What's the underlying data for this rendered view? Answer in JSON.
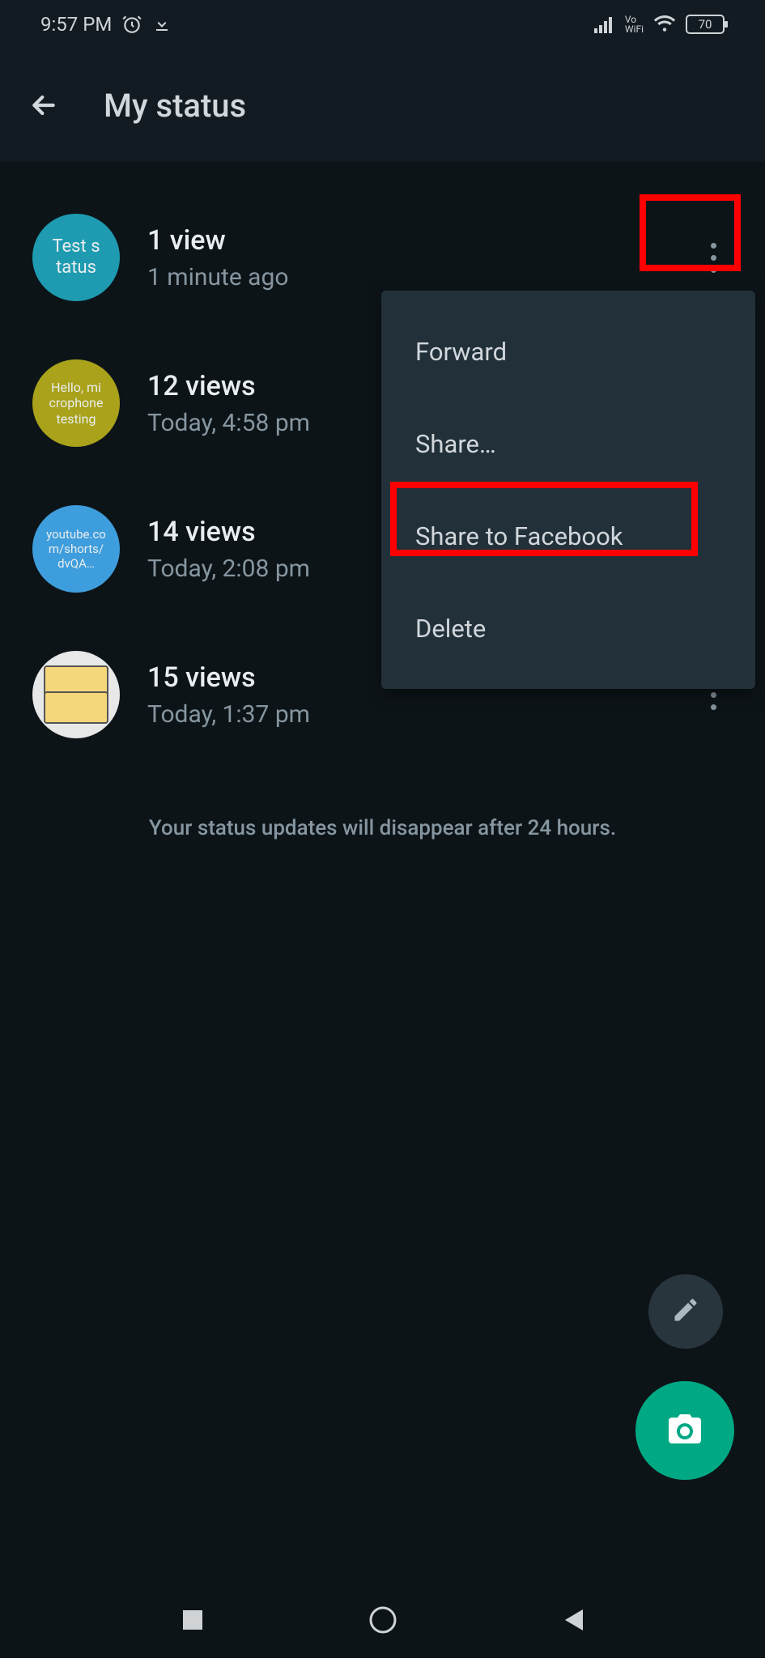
{
  "status_bar": {
    "time": "9:57 PM",
    "vowifi_top": "Vo",
    "vowifi_bottom": "WiFi",
    "battery": "70"
  },
  "app_bar": {
    "title": "My status"
  },
  "items": [
    {
      "thumb_text": "Test s tatus",
      "title": "1 view",
      "subtitle": "1 minute ago"
    },
    {
      "thumb_text": "Hello, mi crophone testing",
      "title": "12 views",
      "subtitle": "Today, 4:58 pm"
    },
    {
      "thumb_text": "youtube.co m/shorts/ dvQA…",
      "title": "14 views",
      "subtitle": "Today, 2:08 pm"
    },
    {
      "thumb_text": "",
      "title": "15 views",
      "subtitle": "Today, 1:37 pm"
    }
  ],
  "popup": {
    "forward": "Forward",
    "share": "Share…",
    "share_fb": "Share to Facebook",
    "delete": "Delete"
  },
  "footer": "Your status updates will disappear after 24 hours."
}
